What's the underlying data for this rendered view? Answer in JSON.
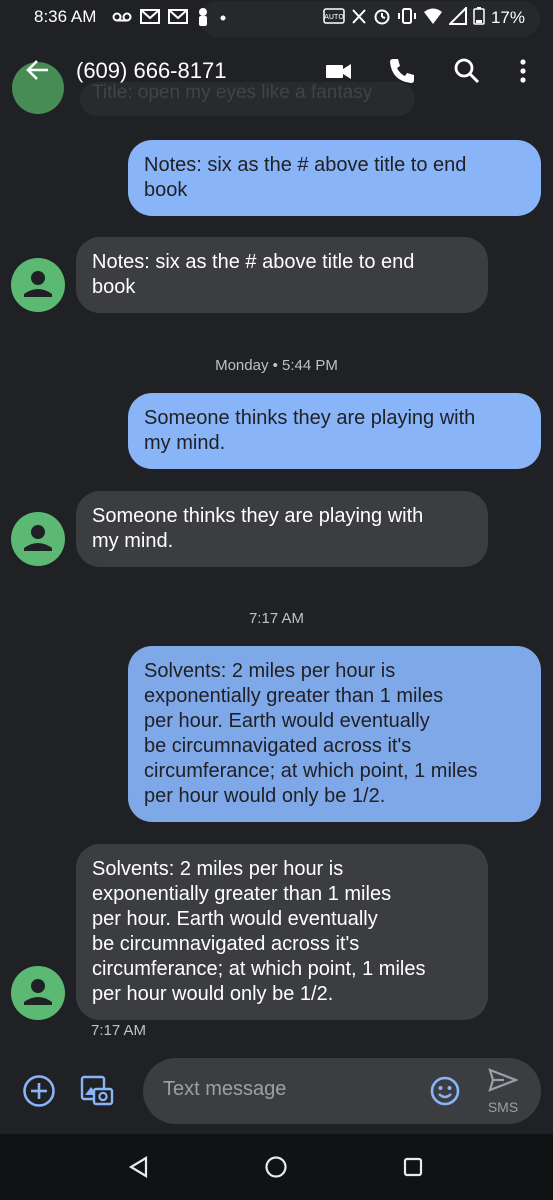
{
  "status_bar": {
    "time": "8:36 AM",
    "battery": "17%",
    "left_icons": [
      "voicemail-icon",
      "gmail-icon",
      "gmail-icon",
      "notification-icon",
      "dot-icon"
    ],
    "right_icons": [
      "auto-icon",
      "x-icon",
      "alarm-icon",
      "vibrate-icon",
      "wifi-icon",
      "signal-icon",
      "battery-icon"
    ]
  },
  "app_bar": {
    "title": "(609) 666-8171",
    "actions": [
      "video-call-icon",
      "phone-icon",
      "search-icon",
      "more-icon"
    ]
  },
  "ghost_preview": "Title: open my eyes like a fantasy",
  "messages": [
    {
      "direction": "out",
      "text_lines": [
        "Notes: six as the # above title to end",
        "book"
      ]
    },
    {
      "direction": "in",
      "text_lines": [
        "Notes: six as the # above title to end",
        "book"
      ]
    },
    {
      "type": "timestamp",
      "text": "Monday • 5:44 PM"
    },
    {
      "direction": "out",
      "text_lines": [
        "Someone thinks they are playing with",
        "my mind."
      ]
    },
    {
      "direction": "in",
      "text_lines": [
        "Someone thinks they are playing with",
        "my mind."
      ]
    },
    {
      "type": "timestamp",
      "text": "7:17 AM"
    },
    {
      "direction": "out",
      "text_lines": [
        "Solvents: 2 miles per hour is",
        "exponentially greater than 1 miles",
        "per hour. Earth would eventually",
        "be circumnavigated across it's",
        "circumferance; at which point, 1 miles",
        "per hour would only be 1/2."
      ]
    },
    {
      "direction": "in",
      "text_lines": [
        "Solvents: 2 miles per hour is",
        "exponentially greater than 1 miles",
        "per hour. Earth would eventually",
        "be circumnavigated across it's",
        "circumferance; at which point, 1 miles",
        "per hour would only be 1/2."
      ],
      "meta": "7:17 AM"
    }
  ],
  "compose": {
    "placeholder": "Text message",
    "send_label": "SMS"
  },
  "colors": {
    "background": "#202124",
    "outgoing_bubble": "#8ab4f8",
    "incoming_bubble": "#3c3d41",
    "avatar": "#5bb974"
  }
}
